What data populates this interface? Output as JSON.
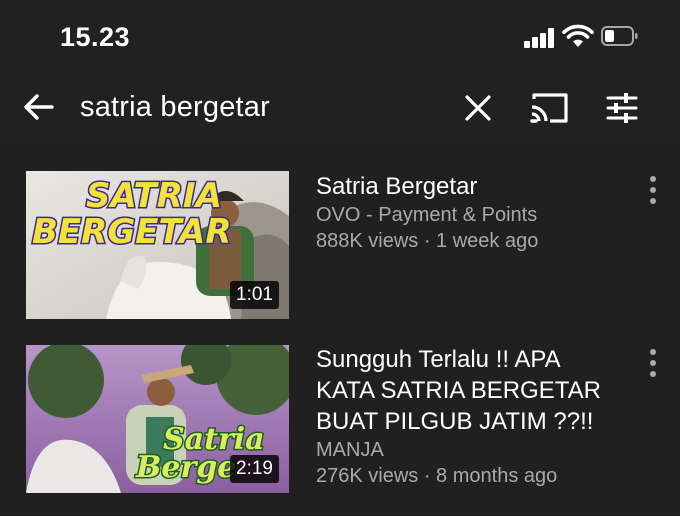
{
  "status_bar": {
    "time": "15.23",
    "icons": [
      "signal-icon",
      "wifi-icon",
      "battery-icon"
    ]
  },
  "search": {
    "query": "satria bergetar",
    "icons": [
      "back-arrow-icon",
      "clear-icon",
      "cast-icon",
      "filter-icon"
    ]
  },
  "results": [
    {
      "title_lines": [
        "Satria Bergetar"
      ],
      "channel": "OVO - Payment & Points",
      "meta": "888K views · 1 week ago",
      "duration": "1:01",
      "thumbnail_text": [
        "SATRIA",
        "BERGETAR"
      ]
    },
    {
      "title_lines": [
        "Sungguh Terlalu !! APA",
        "KATA SATRIA BERGETAR",
        "BUAT PILGUB JATIM ??!!"
      ],
      "channel": "MANJA",
      "meta": "276K views · 8 months ago",
      "duration": "2:19",
      "thumbnail_text": [
        "Satria",
        "Berge"
      ]
    }
  ],
  "colors": {
    "background": "#212121",
    "text_primary": "#ffffff",
    "text_secondary": "#aaaaaa"
  }
}
